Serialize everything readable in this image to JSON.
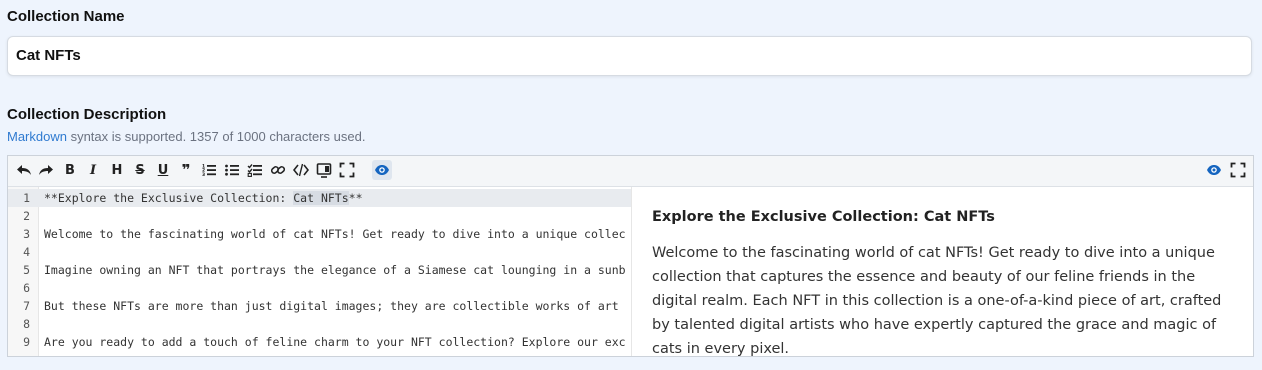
{
  "name_section": {
    "label": "Collection Name",
    "value": "Cat NFTs"
  },
  "description_section": {
    "label": "Collection Description",
    "hint_link": "Markdown",
    "hint_text": " syntax is supported. 1357 of 1000 characters used."
  },
  "toolbar": {
    "left_icons": [
      "undo-icon",
      "redo-icon",
      "bold-icon",
      "italic-icon",
      "heading-icon",
      "strikethrough-icon",
      "underline-icon",
      "quote-icon",
      "ordered-list-icon",
      "unordered-list-icon",
      "checklist-icon",
      "link-icon",
      "code-icon",
      "preview-split-icon",
      "fullscreen-icon",
      "eye-icon"
    ],
    "right_icons": [
      "eye-icon",
      "fullscreen-icon"
    ],
    "bold": "B",
    "italic": "I",
    "heading": "H",
    "strike": "S",
    "underline": "U",
    "quote": "❞"
  },
  "editor": {
    "lines": [
      {
        "n": "1",
        "text": "**Explore the Exclusive Collection: ",
        "sel": "Cat NFTs",
        "after": "**"
      },
      {
        "n": "2",
        "text": ""
      },
      {
        "n": "3",
        "text": "Welcome to the fascinating world of cat NFTs! Get ready to dive into a unique collec"
      },
      {
        "n": "4",
        "text": ""
      },
      {
        "n": "5",
        "text": "Imagine owning an NFT that portrays the elegance of a Siamese cat lounging in a sunb"
      },
      {
        "n": "6",
        "text": ""
      },
      {
        "n": "7",
        "text": "But these NFTs are more than just digital images; they are collectible works of art"
      },
      {
        "n": "8",
        "text": ""
      },
      {
        "n": "9",
        "text": "Are you ready to add a touch of feline charm to your NFT collection? Explore our exc"
      }
    ]
  },
  "preview": {
    "heading": "Explore the Exclusive Collection: Cat NFTs",
    "paragraph": "Welcome to the fascinating world of cat NFTs! Get ready to dive into a unique collection that captures the essence and beauty of our feline friends in the digital realm. Each NFT in this collection is a one-of-a-kind piece of art, crafted by talented digital artists who have expertly captured the grace and magic of cats in every pixel."
  },
  "colors": {
    "background": "#eef4fd",
    "link": "#2f7ad0",
    "accent": "#1565c0"
  }
}
